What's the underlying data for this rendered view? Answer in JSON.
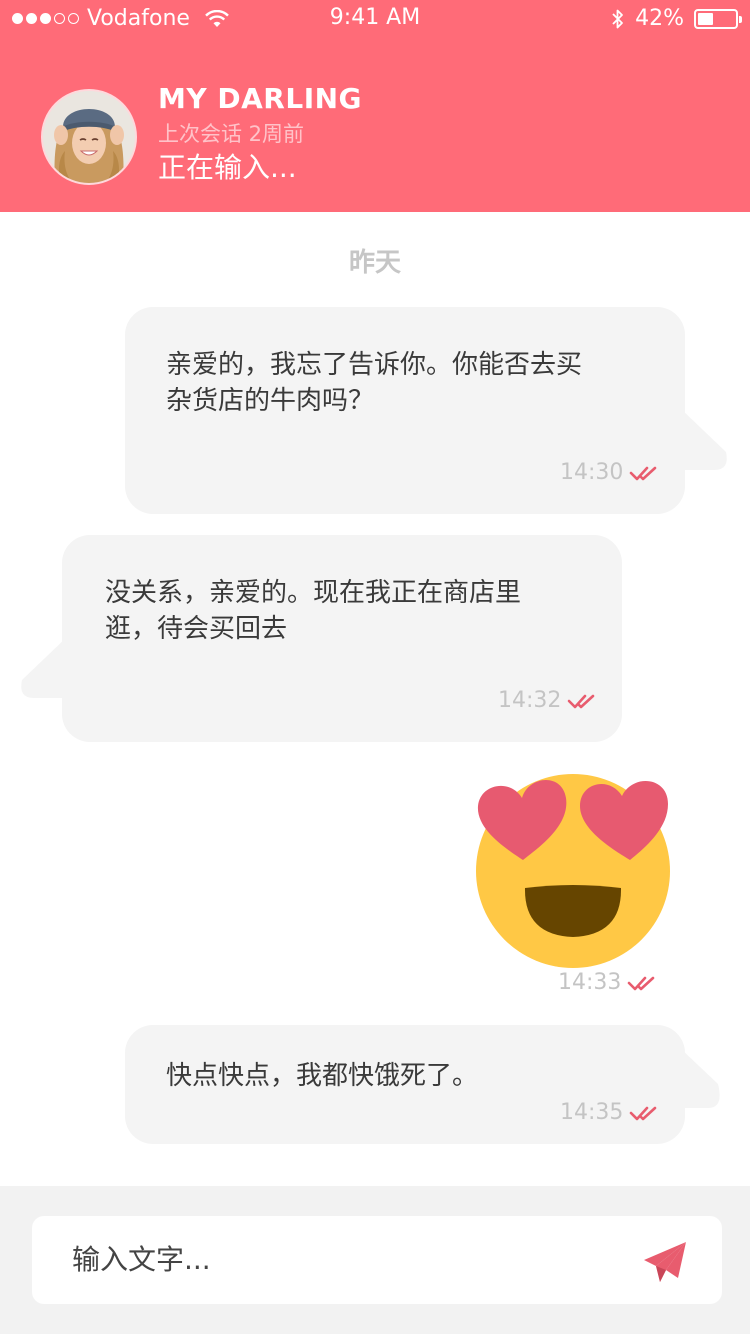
{
  "status_bar": {
    "carrier": "Vodafone",
    "time": "9:41 AM",
    "battery_percent_label": "42%",
    "battery_level": 0.42,
    "signal_bars_filled": 3,
    "signal_bars_total": 5
  },
  "contact": {
    "name": "MY DARLING",
    "last_seen": "上次会话 2周前",
    "typing_status": "正在输入..."
  },
  "chat": {
    "date_separator": "昨天",
    "messages": [
      {
        "side": "right",
        "type": "text",
        "text_line1": "亲爱的，我忘了告诉你。你能否去买",
        "text_line2": "杂货店的牛肉吗？",
        "time": "14:30",
        "read": true
      },
      {
        "side": "left",
        "type": "text",
        "text_line1": "没关系，亲爱的。现在我正在商店里",
        "text_line2": "逛，待会买回去",
        "time": "14:32",
        "read": true
      },
      {
        "side": "right",
        "type": "emoji",
        "emoji": "heart-eyes-emoji",
        "time": "14:33",
        "read": true
      },
      {
        "side": "right",
        "type": "text",
        "text_line1": "快点快点，我都快饿死了。",
        "time": "14:35",
        "read": true
      }
    ]
  },
  "composer": {
    "placeholder": "输入文字..."
  },
  "icons": {
    "send": "paper-plane-icon",
    "read_receipt": "double-check-icon",
    "wifi": "wifi-icon",
    "bluetooth": "bluetooth-icon",
    "battery": "battery-icon"
  },
  "colors": {
    "header": "#ff6b78",
    "accent": "#e85c6e",
    "bubble": "#f4f4f4",
    "emoji_face": "#ffc845",
    "emoji_hearts": "#e75a70"
  }
}
